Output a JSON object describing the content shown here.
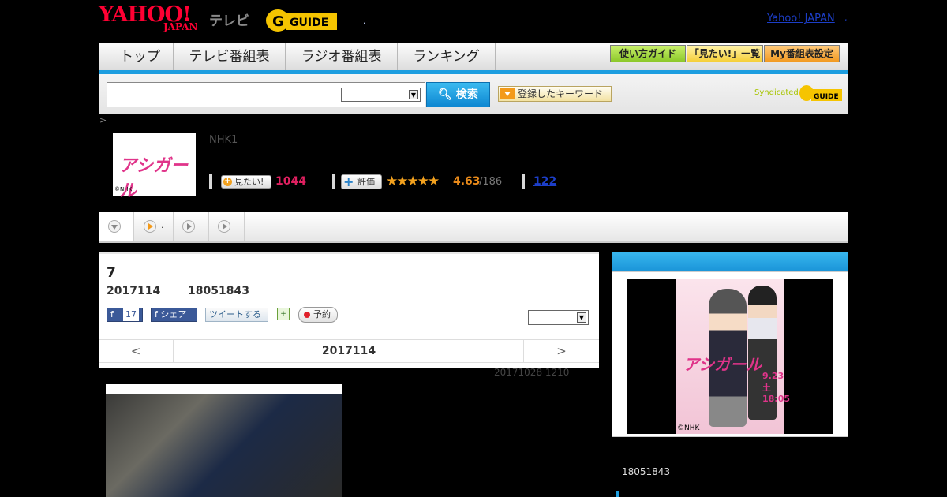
{
  "header": {
    "yahoo_logo": "YAHOO!",
    "yahoo_sub": "JAPAN",
    "tv_label": "テレビ",
    "gguide_logo": "G GUIDE",
    "top_link": "Yahoo! JAPAN",
    "link_dot": ","
  },
  "nav": {
    "items": [
      "トップ",
      "テレビ番組表",
      "ラジオ番組表",
      "ランキング"
    ],
    "buttons": [
      "使い方ガイド",
      "「見たい!」一覧",
      "My番組表設定"
    ]
  },
  "search": {
    "button": "検索",
    "keyword_button": "登録したキーワード",
    "syndicated": "Syndicated"
  },
  "breadcrumb": ">",
  "program": {
    "channel": "NHK1",
    "thumb_title": "アシガール",
    "thumb_credit": "©NHK",
    "want_label": "見たい!",
    "want_count": "1044",
    "rate_label": "評価",
    "stars": "★★★★★",
    "rating": "4.63",
    "rating_count": "/186",
    "review_count": "122"
  },
  "tabs": [
    ".",
    "",
    ""
  ],
  "episode": {
    "number": "7",
    "date": "2017114",
    "time": "18051843",
    "fb_label": "f",
    "fb_count": "17",
    "fb_share": "f シェア",
    "tweet": "ツイートする",
    "reserve": "予約",
    "nav_prev": "<",
    "nav_current": "2017114",
    "nav_next": ">",
    "updated": "20171028  1210"
  },
  "side": {
    "poster_logo": "アシガール",
    "poster_date": "9.23 土 18:05",
    "poster_credit": "©NHK",
    "time": "18051843"
  },
  "colors": {
    "accent_blue": "#1d9ee0",
    "brand_pink": "#e0348a",
    "want_red": "#e02060",
    "rating_orange": "#e98a1a"
  },
  "icons": {
    "search": "search-icon",
    "dropdown": "chevron-down-icon",
    "play": "play-icon"
  }
}
